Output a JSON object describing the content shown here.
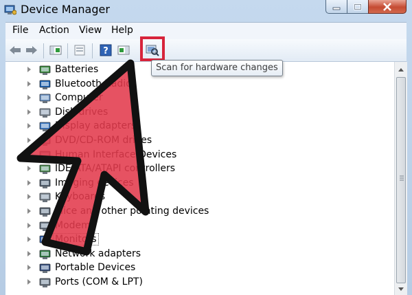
{
  "window": {
    "title": "Device Manager"
  },
  "menu": [
    "File",
    "Action",
    "View",
    "Help"
  ],
  "toolbar": {
    "buttons": [
      "back-icon",
      "forward-icon",
      "show-hide-tree-icon",
      "properties-icon",
      "help-icon",
      "action-pane-icon",
      "scan-hardware-icon"
    ],
    "tooltip": "Scan for hardware changes"
  },
  "tree": [
    {
      "label": "Batteries",
      "icon": "battery-icon"
    },
    {
      "label": "Bluetooth Radios",
      "icon": "bluetooth-icon"
    },
    {
      "label": "Computer",
      "icon": "computer-icon"
    },
    {
      "label": "Disk drives",
      "icon": "disk-drive-icon"
    },
    {
      "label": "Display adapters",
      "icon": "display-adapter-icon"
    },
    {
      "label": "DVD/CD-ROM drives",
      "icon": "dvd-drive-icon"
    },
    {
      "label": "Human Interface Devices",
      "icon": "hid-icon"
    },
    {
      "label": "IDE ATA/ATAPI controllers",
      "icon": "ide-controller-icon"
    },
    {
      "label": "Imaging devices",
      "icon": "imaging-device-icon"
    },
    {
      "label": "Keyboards",
      "icon": "keyboard-icon"
    },
    {
      "label": "Mice and other pointing devices",
      "icon": "mouse-icon"
    },
    {
      "label": "Modems",
      "icon": "modem-icon"
    },
    {
      "label": "Monitors",
      "icon": "monitor-icon"
    },
    {
      "label": "Network adapters",
      "icon": "network-adapter-icon"
    },
    {
      "label": "Portable Devices",
      "icon": "portable-device-icon"
    },
    {
      "label": "Ports (COM & LPT)",
      "icon": "port-icon"
    }
  ],
  "selected_item": "Monitors",
  "colors": {
    "highlight_box": "#d7243b",
    "arrow_fill": "#e23a4c",
    "arrow_outline": "#111111"
  }
}
